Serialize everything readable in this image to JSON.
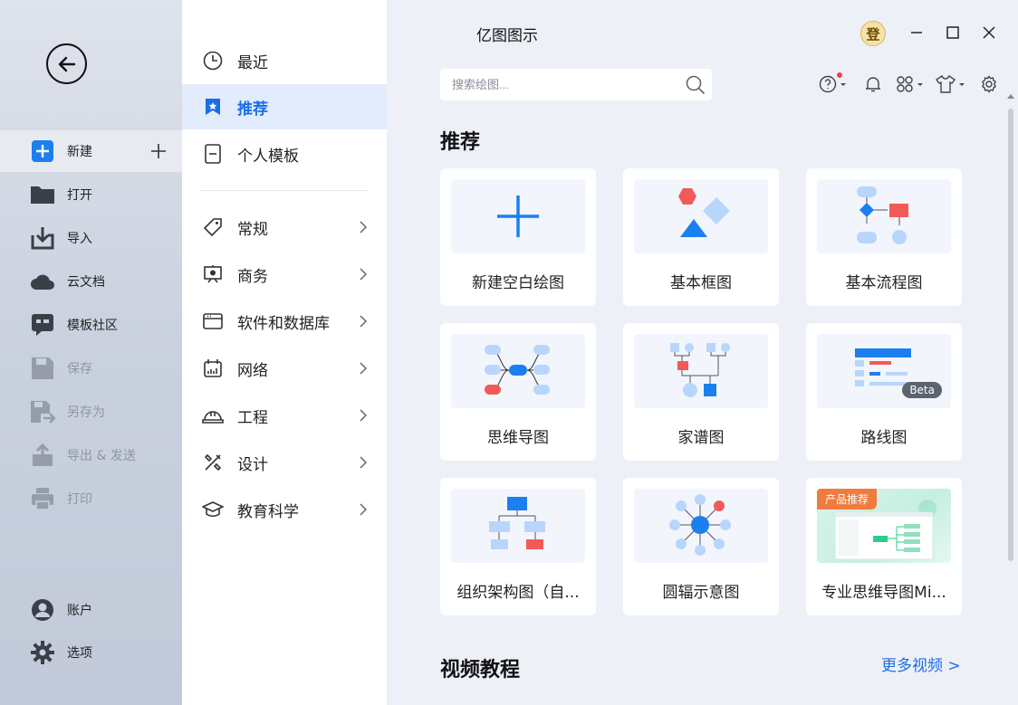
{
  "app": {
    "title": "亿图图示"
  },
  "left_nav": {
    "items": [
      {
        "label": "新建"
      },
      {
        "label": "打开"
      },
      {
        "label": "导入"
      },
      {
        "label": "云文档"
      },
      {
        "label": "模板社区"
      },
      {
        "label": "保存"
      },
      {
        "label": "另存为"
      },
      {
        "label": "导出 & 发送"
      },
      {
        "label": "打印"
      }
    ],
    "bottom": [
      {
        "label": "账户"
      },
      {
        "label": "选项"
      }
    ]
  },
  "middle_nav": {
    "top": [
      {
        "label": "最近"
      },
      {
        "label": "推荐"
      },
      {
        "label": "个人模板"
      }
    ],
    "categories": [
      {
        "label": "常规"
      },
      {
        "label": "商务"
      },
      {
        "label": "软件和数据库"
      },
      {
        "label": "网络"
      },
      {
        "label": "工程"
      },
      {
        "label": "设计"
      },
      {
        "label": "教育科学"
      }
    ]
  },
  "header": {
    "avatar_text": "登",
    "search_placeholder": "搜索绘图..."
  },
  "recommend": {
    "title": "推荐",
    "cards": [
      {
        "label": "新建空白绘图"
      },
      {
        "label": "基本框图"
      },
      {
        "label": "基本流程图"
      },
      {
        "label": "思维导图"
      },
      {
        "label": "家谱图"
      },
      {
        "label": "路线图",
        "badge": "Beta"
      },
      {
        "label": "组织架构图（自..."
      },
      {
        "label": "圆辐示意图"
      },
      {
        "label": "专业思维导图Mi...",
        "badge": "产品推荐"
      }
    ]
  },
  "videos": {
    "title": "视频教程",
    "more": "更多视频 >"
  },
  "colors": {
    "accent": "#1b6ee8",
    "red": "#f25a5a",
    "light_blue": "#b8d6fb"
  }
}
